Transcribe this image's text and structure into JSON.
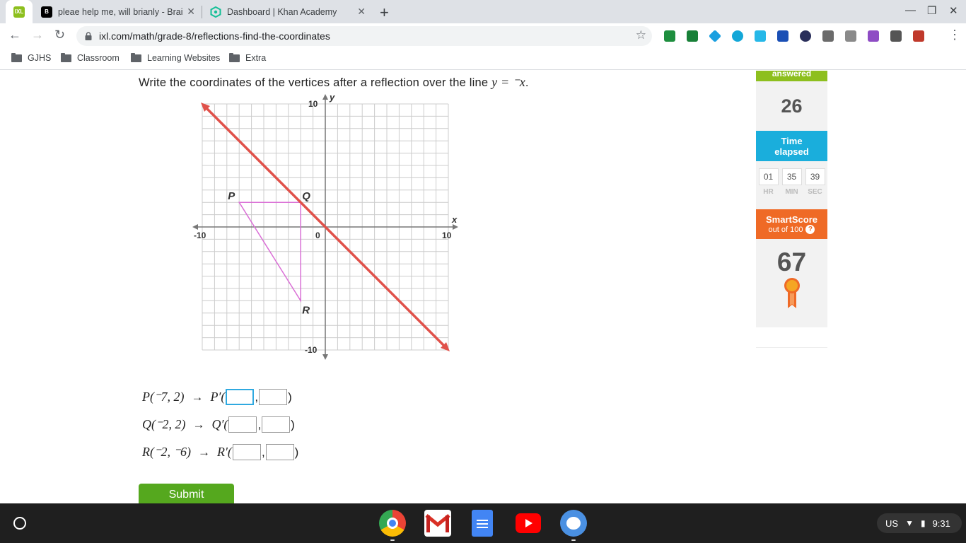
{
  "browser": {
    "tabs": [
      {
        "title": "pleae help me, will brianly - Brainly",
        "favicon_text": "B",
        "favicon_color": "#000000"
      },
      {
        "title": "Dashboard | Khan Academy",
        "favicon_text": "",
        "favicon_color": "#14bf96"
      }
    ],
    "active_favicon_text": "IXL",
    "url": "ixl.com/math/grade-8/reflections-find-the-coordinates"
  },
  "bookmarks": [
    {
      "label": "GJHS",
      "icon": "doc-folder-icon"
    },
    {
      "label": "Classroom",
      "icon": "folder-icon"
    },
    {
      "label": "Learning Websites",
      "icon": "folder-icon"
    },
    {
      "label": "Extra",
      "icon": "folder-icon"
    }
  ],
  "question": {
    "text": "Write the coordinates of the vertices after a reflection over the line",
    "equation": "y = ⁻x",
    "period": "."
  },
  "graph": {
    "x_label": "x",
    "y_label": "y",
    "ticks": {
      "x_min": "-10",
      "x_max": "10",
      "y_max": "10",
      "y_min": "-10",
      "origin": "0"
    },
    "axis_range": [
      -10,
      10
    ],
    "reflection_line": {
      "slope": -1,
      "color": "#e0514a"
    },
    "triangle_color": "#da70d6",
    "points": [
      {
        "label": "P",
        "x": -7,
        "y": 2
      },
      {
        "label": "Q",
        "x": -2,
        "y": 2
      },
      {
        "label": "R",
        "x": -2,
        "y": -6
      }
    ]
  },
  "answers": [
    {
      "left": "P(⁻7, 2)",
      "arrow": "→",
      "right": "P′(",
      "sep": ",",
      "close": ")"
    },
    {
      "left": "Q(⁻2, 2)",
      "arrow": "→",
      "right": "Q′(",
      "sep": ",",
      "close": ")"
    },
    {
      "left": "R(⁻2, ⁻6)",
      "arrow": "→",
      "right": "R′(",
      "sep": ",",
      "close": ")"
    }
  ],
  "submit_label": "Submit",
  "sidebar": {
    "answered_label": "answered",
    "answered_count": "26",
    "time_label_1": "Time",
    "time_label_2": "elapsed",
    "timer": [
      {
        "value": "01",
        "unit": "HR"
      },
      {
        "value": "35",
        "unit": "MIN"
      },
      {
        "value": "39",
        "unit": "SEC"
      }
    ],
    "smartscore_label": "SmartScore",
    "smartscore_sub": "out of 100",
    "smartscore_help": "?",
    "smartscore_value": "67"
  },
  "taskbar": {
    "tray_locale": "US",
    "tray_time": "9:31"
  },
  "colors": {
    "ixl_green": "#55a81e",
    "time_blue": "#1aaedc",
    "score_orange": "#ef6a26"
  }
}
